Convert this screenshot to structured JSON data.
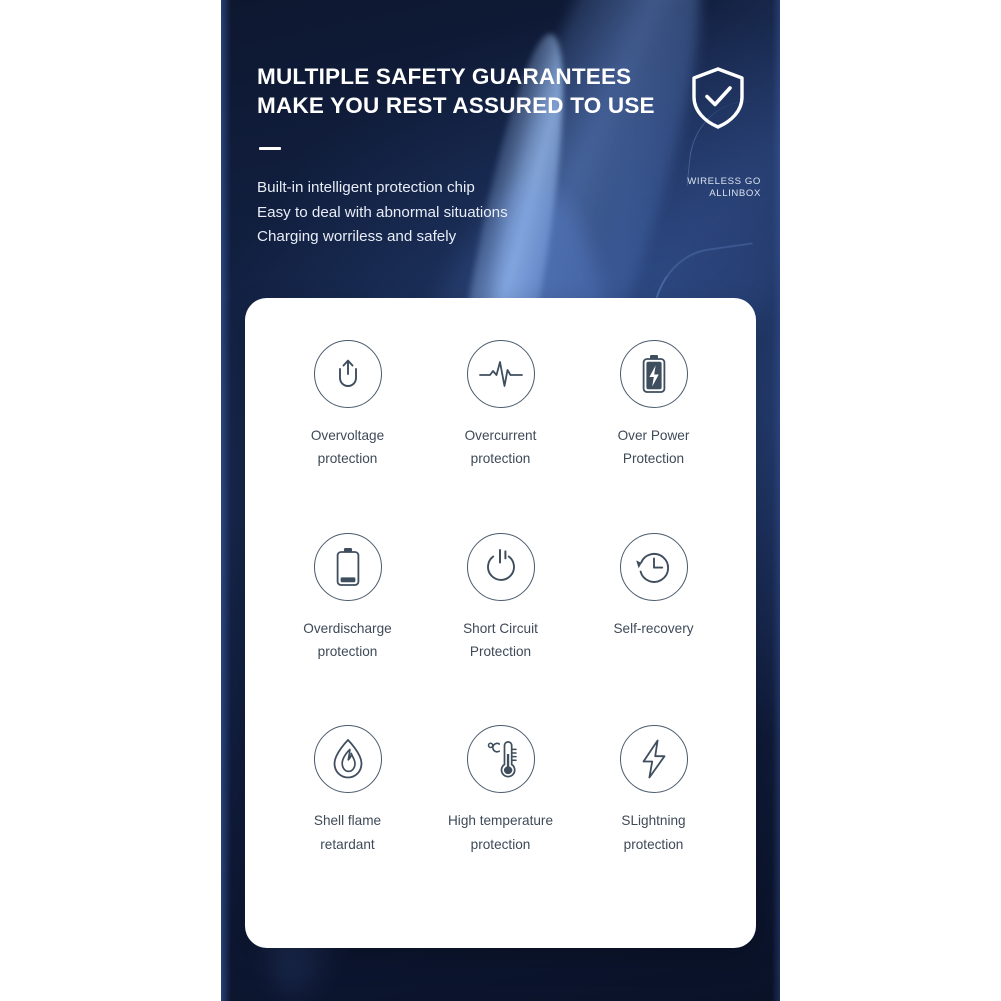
{
  "panel": {
    "headline": "MULTIPLE SAFETY GUARANTEES\nMAKE  YOU REST ASSURED TO USE",
    "sub_lines": [
      "Built-in intelligent protection chip",
      "Easy to deal with abnormal situations",
      "Charging worriless and safely"
    ],
    "brand": {
      "line1": "WIRELESS GO",
      "line2": "ALLINBOX",
      "shield_icon": "shield-check-icon"
    },
    "colors": {
      "background_dark": "#101c3c",
      "background_deep": "#0a1228",
      "glow_blue": "#6f9cf0",
      "text_light": "#ffffff",
      "card_background": "#ffffff",
      "icon_stroke": "#4a5a6c",
      "label_text": "#3e4a58"
    }
  },
  "features": [
    {
      "icon": "overvoltage-icon",
      "label": "Overvoltage\nprotection"
    },
    {
      "icon": "overcurrent-ecg-icon",
      "label": "Overcurrent\nprotection"
    },
    {
      "icon": "over-power-battery-icon",
      "label": "Over Power\nProtection"
    },
    {
      "icon": "overdischarge-battery-icon",
      "label": "Overdischarge\nprotection"
    },
    {
      "icon": "short-circuit-power-icon",
      "label": "Short Circuit\nProtection"
    },
    {
      "icon": "self-recovery-clock-icon",
      "label": "Self-recovery"
    },
    {
      "icon": "shell-flame-icon",
      "label": "Shell flame\nretardant"
    },
    {
      "icon": "high-temperature-thermometer-icon",
      "label": "High temperature\nprotection"
    },
    {
      "icon": "lightning-protection-icon",
      "label": "SLightning\nprotection"
    }
  ]
}
